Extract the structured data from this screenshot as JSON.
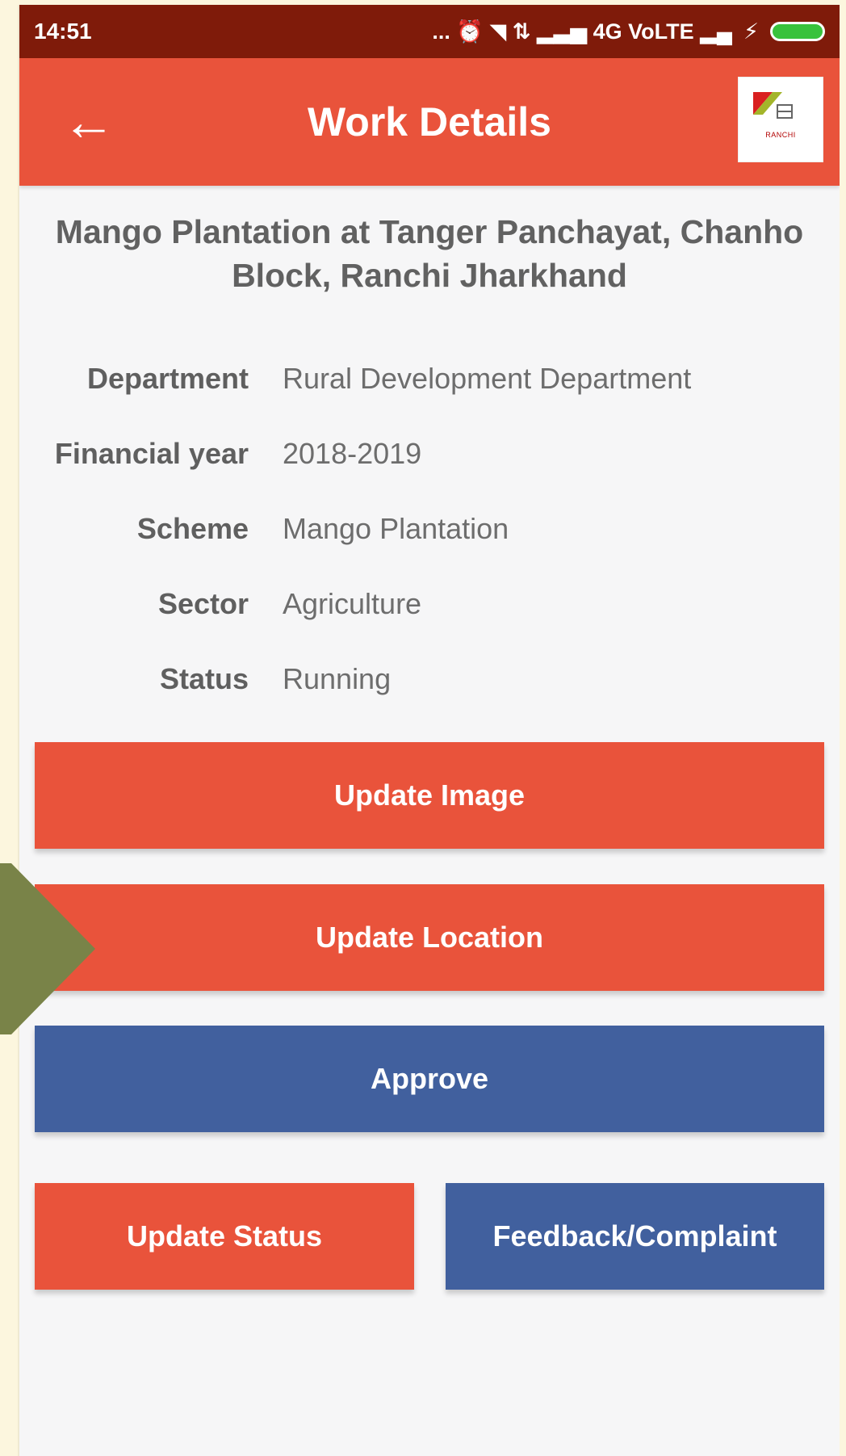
{
  "status_bar": {
    "time": "14:51",
    "indicators": "... ⏰ ◥ ⇅ ▂▃▅ 4G VoLTE ▂▄",
    "battery": "charging"
  },
  "app_bar": {
    "title": "Work Details",
    "back_icon": "←",
    "logo_text": "RANCHI"
  },
  "work": {
    "title": "Mango Plantation at Tanger Panchayat, Chanho Block, Ranchi Jharkhand",
    "details": [
      {
        "label": "Department",
        "value": "Rural Development Department"
      },
      {
        "label": "Financial year",
        "value": "2018-2019"
      },
      {
        "label": "Scheme",
        "value": "Mango Plantation"
      },
      {
        "label": "Sector",
        "value": "Agriculture"
      },
      {
        "label": "Status",
        "value": "Running"
      }
    ]
  },
  "buttons": {
    "update_image": "Update Image",
    "update_location": "Update Location",
    "approve": "Approve",
    "update_status": "Update Status",
    "feedback": "Feedback/Complaint"
  },
  "colors": {
    "primary_red": "#e9533b",
    "primary_blue": "#41609e",
    "status_bar": "#7f1b0a",
    "arrow": "#798348"
  }
}
